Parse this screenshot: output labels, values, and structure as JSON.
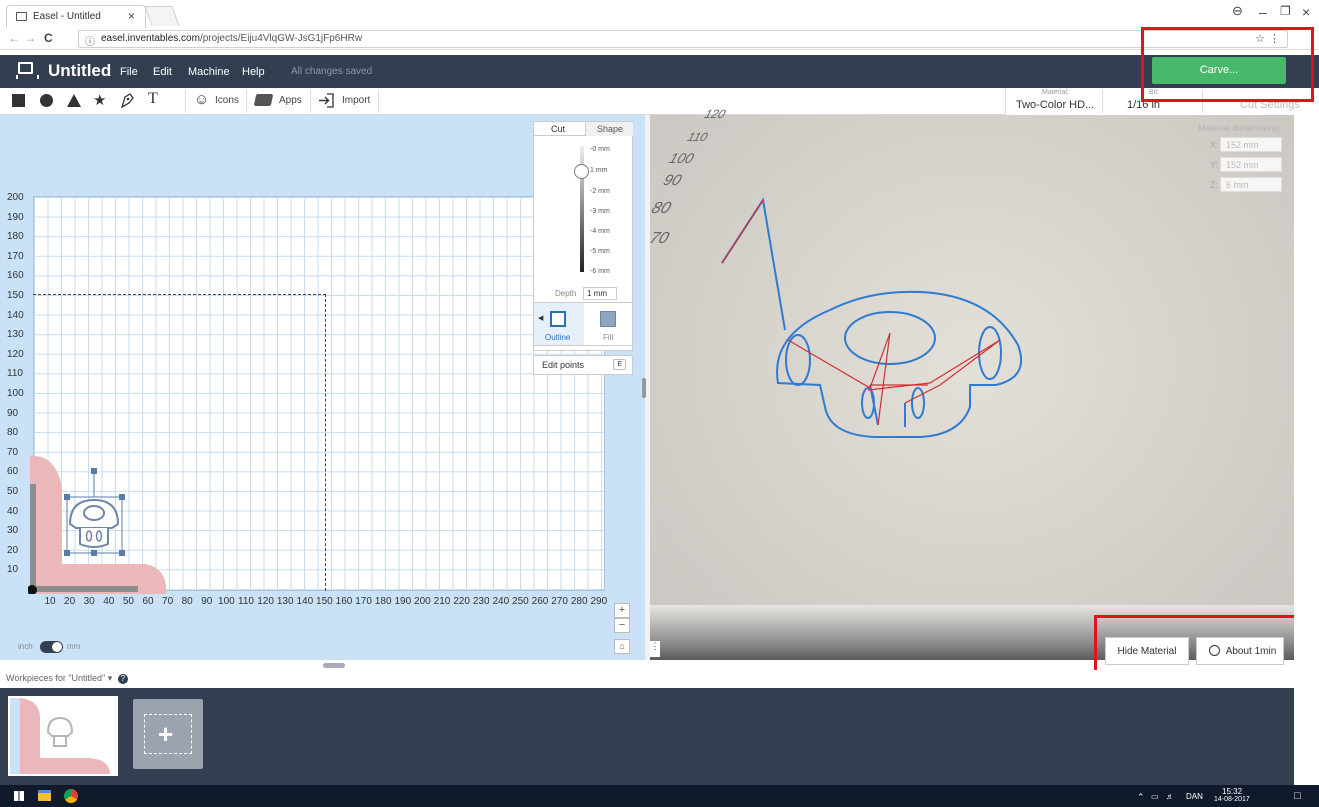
{
  "browser": {
    "tab_title": "Easel - Untitled",
    "tab_close": "×",
    "url_host": "easel.inventables.com",
    "url_path": "/projects/Eiju4VlqGW-JsG1jFp6HRw",
    "back": "←",
    "forward": "→",
    "reload": "C",
    "minimize": "–",
    "restore": "❐",
    "close": "×"
  },
  "app": {
    "title": "Untitled",
    "menu": [
      "File",
      "Edit",
      "Machine",
      "Help"
    ],
    "status": "All changes saved",
    "carve_label": "Carve..."
  },
  "toolbar": {
    "icons_label": "Icons",
    "apps_label": "Apps",
    "import_label": "Import",
    "material_caption": "Material:",
    "material_value": "Two-Color HD...",
    "bit_caption": "Bit:",
    "bit_value": "1/16 in",
    "cut_settings": "Cut Settings"
  },
  "canvas": {
    "y_ticks": [
      "200",
      "190",
      "180",
      "170",
      "160",
      "150",
      "140",
      "130",
      "120",
      "110",
      "100",
      "90",
      "80",
      "70",
      "60",
      "50",
      "40",
      "30",
      "20",
      "10"
    ],
    "x_ticks": [
      "10",
      "20",
      "30",
      "40",
      "50",
      "60",
      "70",
      "80",
      "90",
      "100",
      "110",
      "120",
      "130",
      "140",
      "150",
      "160",
      "170",
      "180",
      "190",
      "200",
      "210",
      "220",
      "230",
      "240",
      "250",
      "260",
      "270",
      "280",
      "290"
    ],
    "unit_left": "inch",
    "unit_right": "mm",
    "zoom_in": "+",
    "zoom_out": "−"
  },
  "cut_panel": {
    "tab_cut": "Cut",
    "tab_shape": "Shape",
    "depth_ticks": [
      "-0 mm",
      "1 mm",
      "-2 mm",
      "-3 mm",
      "-4 mm",
      "-5 mm",
      "-6 mm"
    ],
    "depth_label": "Depth",
    "depth_value": "1 mm",
    "outline_label": "Outline",
    "fill_label": "Fill",
    "edit_points": "Edit points",
    "edit_points_key": "E"
  },
  "preview": {
    "ruler_ticks": [
      "120",
      "110",
      "100",
      "90",
      "80",
      "70"
    ],
    "dims_caption": "Material dimensions:",
    "x_label": "X:",
    "x_value": "152 mm",
    "y_label": "Y:",
    "y_value": "152 mm",
    "z_label": "Z:",
    "z_value": "6 mm",
    "hide_material": "Hide Material",
    "estimate": "About 1min"
  },
  "workpieces": {
    "header": "Workpieces for \"Untitled\"",
    "header_caret": "▾",
    "add_label": "+"
  },
  "taskbar": {
    "lang": "DAN",
    "time": "15:32",
    "date": "14-08-2017"
  },
  "colors": {
    "app_bar": "#333f50",
    "carve_green": "#48b96a",
    "canvas_bg": "#c9e2f7",
    "highlight_red": "#e0141c",
    "toolpath_blue": "#2f7bd0",
    "travel_red": "#d23030"
  }
}
